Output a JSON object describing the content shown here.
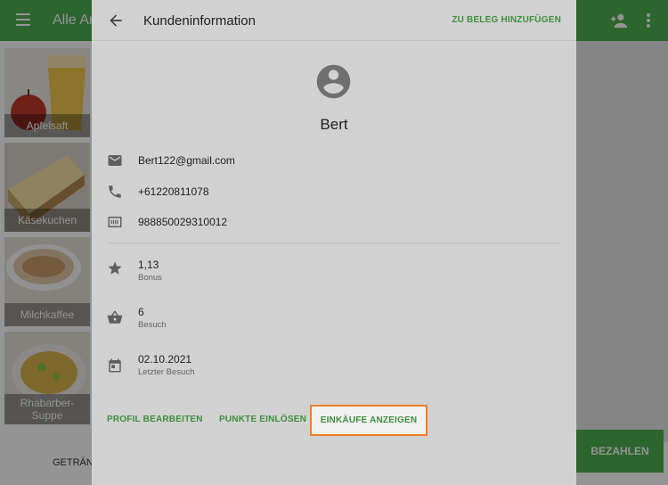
{
  "app": {
    "title": "Alle Ar",
    "bottom_label": "GETRÄNK",
    "pay_label": "BEZAHLEN"
  },
  "tiles": [
    {
      "label": "Apfelsaft"
    },
    {
      "label": "Käsekuchen"
    },
    {
      "label": "Milchkaffee"
    },
    {
      "label": "Rhabarber-Suppe",
      "line1": "Rhabarber-",
      "line2": "Suppe"
    }
  ],
  "dialog": {
    "title": "Kundeninformation",
    "add_to_receipt": "ZU BELEG HINZUFÜGEN",
    "customer_name": "Bert",
    "email": "Bert122@gmail.com",
    "phone": "+61220811078",
    "card_number": "988850029310012",
    "bonus_value": "1,13",
    "bonus_label": "Bonus",
    "visits_value": "6",
    "visits_label": "Besuch",
    "last_visit_value": "02.10.2021",
    "last_visit_label": "Letzter Besuch",
    "actions": {
      "edit_profile": "PROFIL BEARBEITEN",
      "redeem_points": "PUNKTE EINLÖSEN",
      "show_purchases": "EINKÄUFE ANZEIGEN"
    }
  },
  "colors": {
    "accent": "#3f8f3f",
    "app_bar": "#4caf50",
    "highlight": "#ef7e2d"
  },
  "icons": [
    "menu-icon",
    "add-person-icon",
    "more-vert-icon",
    "back-arrow-icon",
    "account-circle-icon",
    "email-icon",
    "phone-icon",
    "card-icon",
    "star-icon",
    "basket-icon",
    "calendar-icon"
  ]
}
